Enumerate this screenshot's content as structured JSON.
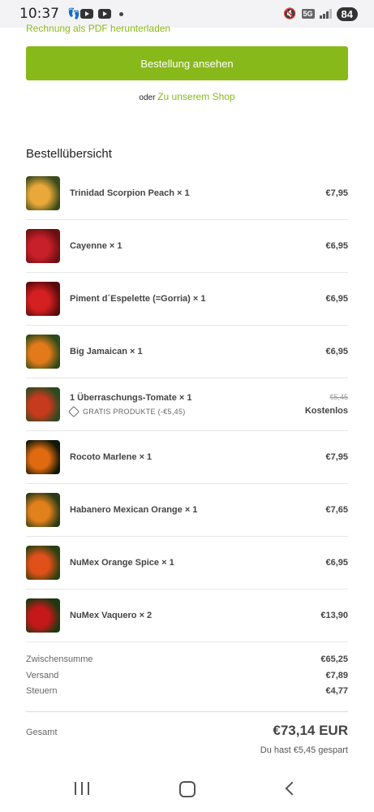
{
  "status_bar": {
    "time": "10:37",
    "network": "5G",
    "battery": "84"
  },
  "top_link": "Rechnung als PDF herunterladen",
  "view_order_button": "Bestellung ansehen",
  "or_text": "oder",
  "shop_link": "Zu unserem Shop",
  "summary_title": "Bestellübersicht",
  "items": [
    {
      "name": "Trinidad Scorpion Peach × 1",
      "price": "€7,95",
      "colors": [
        "#3a4a1a",
        "#e8a83a"
      ]
    },
    {
      "name": "Cayenne × 1",
      "price": "€6,95",
      "colors": [
        "#6b1010",
        "#c8202a"
      ]
    },
    {
      "name": "Piment d´Espelette (=Gorria) × 1",
      "price": "€6,95",
      "colors": [
        "#5a0a0a",
        "#d42020"
      ]
    },
    {
      "name": "Big Jamaican × 1",
      "price": "€6,95",
      "colors": [
        "#2e4a18",
        "#e27a1a"
      ]
    },
    {
      "name": "1 Überraschungs-Tomate × 1",
      "old_price": "€5,45",
      "price": "Kostenlos",
      "discount": "GRATIS PRODUKTE (-€5,45)",
      "colors": [
        "#2a4a20",
        "#c63a1e"
      ]
    },
    {
      "name": "Rocoto Marlene × 1",
      "price": "€7,95",
      "colors": [
        "#101808",
        "#e06a10"
      ]
    },
    {
      "name": "Habanero Mexican Orange × 1",
      "price": "€7,65",
      "colors": [
        "#2a3a14",
        "#e2801c"
      ]
    },
    {
      "name": "NuMex Orange Spice × 1",
      "price": "€6,95",
      "colors": [
        "#2a4010",
        "#e0501a"
      ]
    },
    {
      "name": "NuMex Vaquero × 2",
      "price": "€13,90",
      "colors": [
        "#1a3a10",
        "#c4181a"
      ]
    }
  ],
  "totals": [
    {
      "label": "Zwischensumme",
      "value": "€65,25"
    },
    {
      "label": "Versand",
      "value": "€7,89"
    },
    {
      "label": "Steuern",
      "value": "€4,77"
    }
  ],
  "grand_total": {
    "label": "Gesamt",
    "value": "€73,14 EUR",
    "saved": "Du hast €5,45 gespart"
  },
  "accent_color": "#88b91a"
}
